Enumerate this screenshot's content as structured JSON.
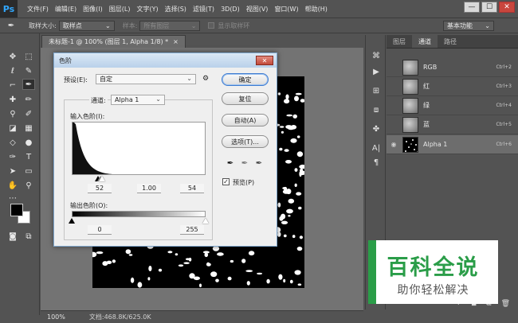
{
  "app": {
    "logo": "Ps",
    "menu": [
      "文件(F)",
      "编辑(E)",
      "图像(I)",
      "图层(L)",
      "文字(Y)",
      "选择(S)",
      "滤镜(T)",
      "3D(D)",
      "视图(V)",
      "窗口(W)",
      "帮助(H)"
    ],
    "window_controls": [
      "—",
      "☐",
      "✕"
    ]
  },
  "options_bar": {
    "sample_size_label": "取样大小:",
    "sample_size_value": "取样点",
    "sample_label": "样本:",
    "sample_value": "所有图层",
    "show_ring_label": "显示取样环",
    "workspace": "基本功能"
  },
  "document": {
    "tab_title": "未标题-1 @ 100% (图层 1, Alpha 1/8) *",
    "tab_close": "×",
    "zoom": "100%",
    "doc_size": "文档:468.8K/625.0K"
  },
  "panel": {
    "tabs": [
      "图层",
      "通道",
      "路径"
    ],
    "active_tab": 1,
    "channels": [
      {
        "name": "RGB",
        "shortcut": "Ctrl+2",
        "visible": false,
        "selected": false,
        "thumb": "gray"
      },
      {
        "name": "红",
        "shortcut": "Ctrl+3",
        "visible": false,
        "selected": false,
        "thumb": "gray"
      },
      {
        "name": "绿",
        "shortcut": "Ctrl+4",
        "visible": false,
        "selected": false,
        "thumb": "gray"
      },
      {
        "name": "蓝",
        "shortcut": "Ctrl+5",
        "visible": false,
        "selected": false,
        "thumb": "gray"
      },
      {
        "name": "Alpha 1",
        "shortcut": "Ctrl+6",
        "visible": true,
        "selected": true,
        "thumb": "alpha"
      }
    ]
  },
  "dialog": {
    "title": "色阶",
    "close": "✕",
    "preset_label": "预设(E):",
    "preset_value": "自定",
    "channel_label": "通道:",
    "channel_value": "Alpha 1",
    "input_label": "输入色阶(I):",
    "output_label": "输出色阶(O):",
    "input_black": "52",
    "input_gamma": "1.00",
    "input_white": "54",
    "output_black": "0",
    "output_white": "255",
    "ok": "确定",
    "reset": "复位",
    "auto": "自动(A)",
    "options": "选项(T)...",
    "preview_label": "预览(P)",
    "preview_checked": "✓"
  },
  "watermark": {
    "title": "百科全说",
    "subtitle": "助你轻松解决"
  }
}
